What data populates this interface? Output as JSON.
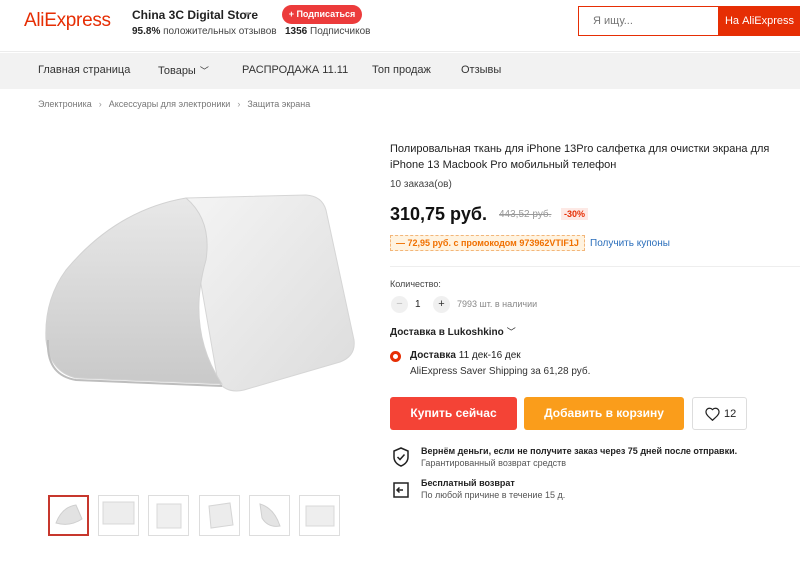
{
  "header": {
    "logo": "AliExpress",
    "store_name": "China 3C Digital Store",
    "positive_pct": "95.8%",
    "positive_label": "положительных отзывов",
    "follow_label": "+ Подписаться",
    "subscribers_count": "1356",
    "subscribers_label": "Подписчиков",
    "search_placeholder": "Я ищу...",
    "search_button": "На AliExpress"
  },
  "nav": {
    "items": [
      "Главная страница",
      "Товары",
      "РАСПРОДАЖА 11.11",
      "Топ продаж",
      "Отзывы"
    ]
  },
  "breadcrumb": [
    "Электроника",
    "Аксессуары для электроники",
    "Защита экрана"
  ],
  "product": {
    "title": "Полировальная ткань для iPhone 13Pro салфетка для очистки экрана для iPhone 13 Macbook Pro мобильный телефон",
    "orders": "10 заказа(ов)",
    "price": "310,75 руб.",
    "old_price": "443,52 руб.",
    "discount": "-30%",
    "promo": "— 72,95 руб. с промокодом 973962VTIF1J",
    "coupons_link": "Получить купоны",
    "quantity_label": "Количество:",
    "quantity_value": "1",
    "stock": "7993 шт. в наличии",
    "delivery_to": "Доставка в Lukoshkino",
    "delivery_label": "Доставка",
    "delivery_dates": "11 дек-16 дек",
    "shipping": "AliExpress Saver Shipping за 61,28 руб.",
    "buy_now": "Купить сейчас",
    "add_to_cart": "Добавить в корзину",
    "wishlist_count": "12",
    "guarantee_title": "Вернём деньги, если не получите заказ через 75 дней после отправки.",
    "guarantee_sub": "Гарантированный возврат средств",
    "return_title": "Бесплатный возврат",
    "return_sub": "По любой причине в течение 15 д."
  },
  "colors": {
    "brand": "#e62e04",
    "buy_button": "#f44336",
    "cart_button": "#fa9d1b",
    "link": "#2a6ebb"
  }
}
